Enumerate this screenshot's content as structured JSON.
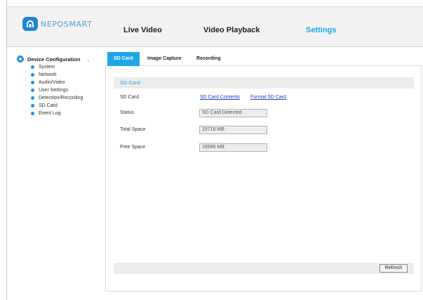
{
  "brand": {
    "logo_text": "NEPOSMART"
  },
  "nav": {
    "items": [
      "Live Video",
      "Video Playback",
      "Settings"
    ],
    "active": "Settings",
    "accent_color": "#1fa8e6"
  },
  "sidebar": {
    "header": "Device Configuration",
    "header_trailer": ".",
    "items": [
      "System",
      "Network",
      "Audio/Video",
      "User Settings",
      "Detection/Recording",
      "SD Card",
      "Event Log"
    ]
  },
  "tabs": {
    "items": [
      "SD Card",
      "Image Capture",
      "Recording"
    ],
    "active": "SD Card"
  },
  "sd_card": {
    "section_title": "SD Card",
    "rows": {
      "sd_card_label": "SD Card",
      "contents_link": "SD Card Contents",
      "format_link": "Format SD Card",
      "status_label": "Status",
      "status_value": "SD Card Detected",
      "total_label": "Total Space",
      "total_value": "29716 MB",
      "free_label": "Free Space",
      "free_value": "28596 MB"
    },
    "refresh_label": "Refresh"
  }
}
